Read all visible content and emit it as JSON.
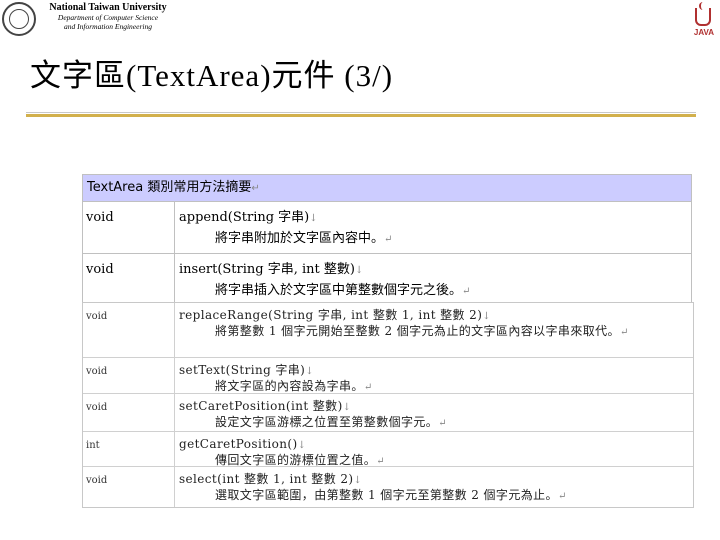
{
  "header": {
    "university": "National Taiwan University",
    "department_line1": "Department of Computer Science",
    "department_line2": "and Information Engineering",
    "java_logo_text": "JAVA"
  },
  "slide": {
    "title": "文字區(TextArea)元件 (3/)"
  },
  "table_top": {
    "header": "TextArea 類別常用方法摘要",
    "rows": [
      {
        "type": "void",
        "signature": "append(String 字串)",
        "description": "將字串附加於文字區內容中。"
      },
      {
        "type": "void",
        "signature": "insert(String 字串, int 整數)",
        "description": "將字串插入於文字區中第整數個字元之後。"
      }
    ]
  },
  "table_bottom": {
    "rows": [
      {
        "type": "void",
        "signature": "replaceRange(String 字串, int 整數 1, int 整數 2)",
        "description": "將第整數 1 個字元開始至整數 2 個字元為止的文字區內容以字串來取代。"
      },
      {
        "type": "void",
        "signature": "setText(String 字串)",
        "description": "將文字區的內容設為字串。"
      },
      {
        "type": "void",
        "signature": "setCaretPosition(int 整數)",
        "description": "設定文字區游標之位置至第整數個字元。"
      },
      {
        "type": "int",
        "signature": "getCaretPosition()",
        "description": "傳回文字區的游標位置之值。"
      },
      {
        "type": "void",
        "signature": "select(int 整數 1, int 整數 2)",
        "description": "選取文字區範圍，由第整數 1 個字元至第整數 2 個字元為止。"
      }
    ]
  },
  "colors": {
    "table_header_bg": "#ccccff",
    "title_rule": "#d2b04c"
  }
}
